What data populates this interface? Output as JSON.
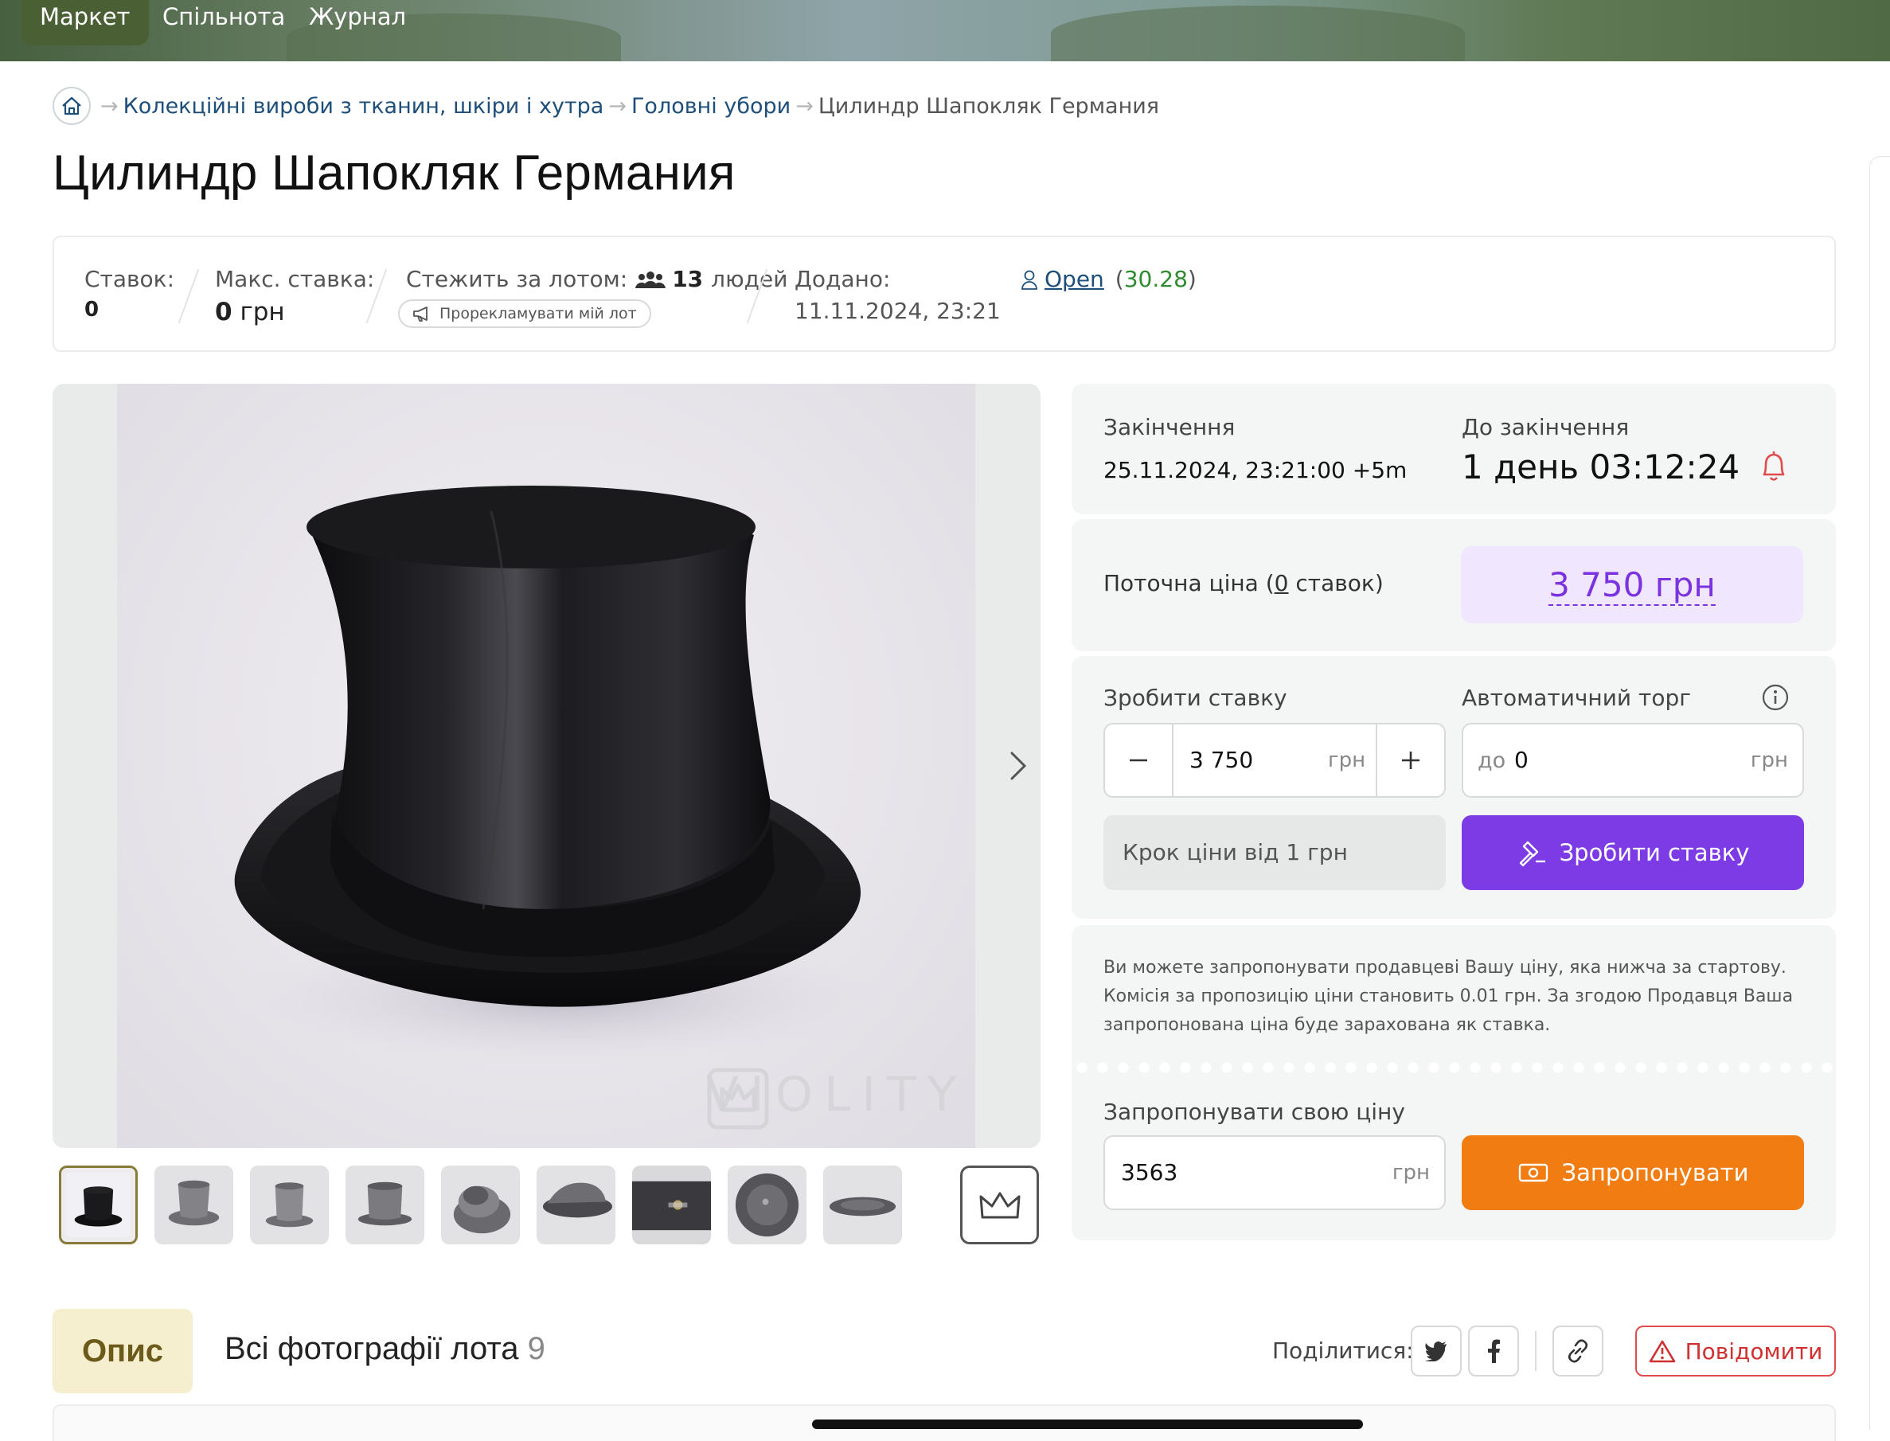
{
  "nav": {
    "items": [
      "Маркет",
      "Спільнота",
      "Журнал"
    ]
  },
  "breadcrumbs": {
    "items": [
      "Колекційні вироби з тканин, шкіри і хутра",
      "Головні убори",
      "Цилиндр Шапокляк Германия"
    ]
  },
  "title": "Цилиндр Шапокляк Германия",
  "stats": {
    "bids_label": "Ставок:",
    "bids_value": "0",
    "max_bid_label": "Макс. ставка:",
    "max_bid_value": "0",
    "max_bid_currency": "грн",
    "watch_label": "Стежить за лотом:",
    "watch_count": "13",
    "watch_suffix": "людей",
    "promo_label": "Прорекламувати мій лот",
    "added_label": "Додано:",
    "added_value": "11.11.2024, 23:21",
    "seller_name": "Open",
    "seller_rating": "30.28"
  },
  "gallery": {
    "watermark": "VIOLITY",
    "thumb_count": 9
  },
  "auction": {
    "end_label": "Закінчення",
    "end_value": "25.11.2024, 23:21:00 +5m",
    "remaining_label": "До закінчення",
    "remaining_value": "1 день 03:12:24",
    "current_price_label": "Поточна ціна",
    "current_price_bids": "0",
    "current_price_bids_suffix": "ставок",
    "current_price_value": "3 750 грн",
    "make_bid_label": "Зробити ставку",
    "auto_bid_label": "Автоматичний торг",
    "bid_amount": "3 750",
    "bid_currency": "грн",
    "auto_prefix": "до",
    "auto_amount": "0",
    "auto_currency": "грн",
    "step_label": "Крок ціни від 1 грн",
    "bid_button": "Зробити ставку",
    "offer_note": "Ви можете запропонувати продавцеві Вашу ціну, яка нижча за стартову. Комісія за пропозицію ціни становить 0.01 грн. За згодою Продавця Ваша запропонована ціна буде зарахована як ставка.",
    "offer_label": "Запропонувати свою ціну",
    "offer_amount": "3563",
    "offer_currency": "грн",
    "offer_button": "Запропонувати"
  },
  "bottom": {
    "tab_description": "Опис",
    "tab_all_photos": "Всі фотографії лота",
    "tab_all_photos_count": "9",
    "share_label": "Поділитися:",
    "report_button": "Повідомити"
  },
  "colors": {
    "accent_purple": "#7b33e0",
    "accent_orange": "#f07c12",
    "link_blue": "#1e4f7a",
    "rating_green": "#2e8b2e",
    "alert_red": "#e04b4b"
  }
}
